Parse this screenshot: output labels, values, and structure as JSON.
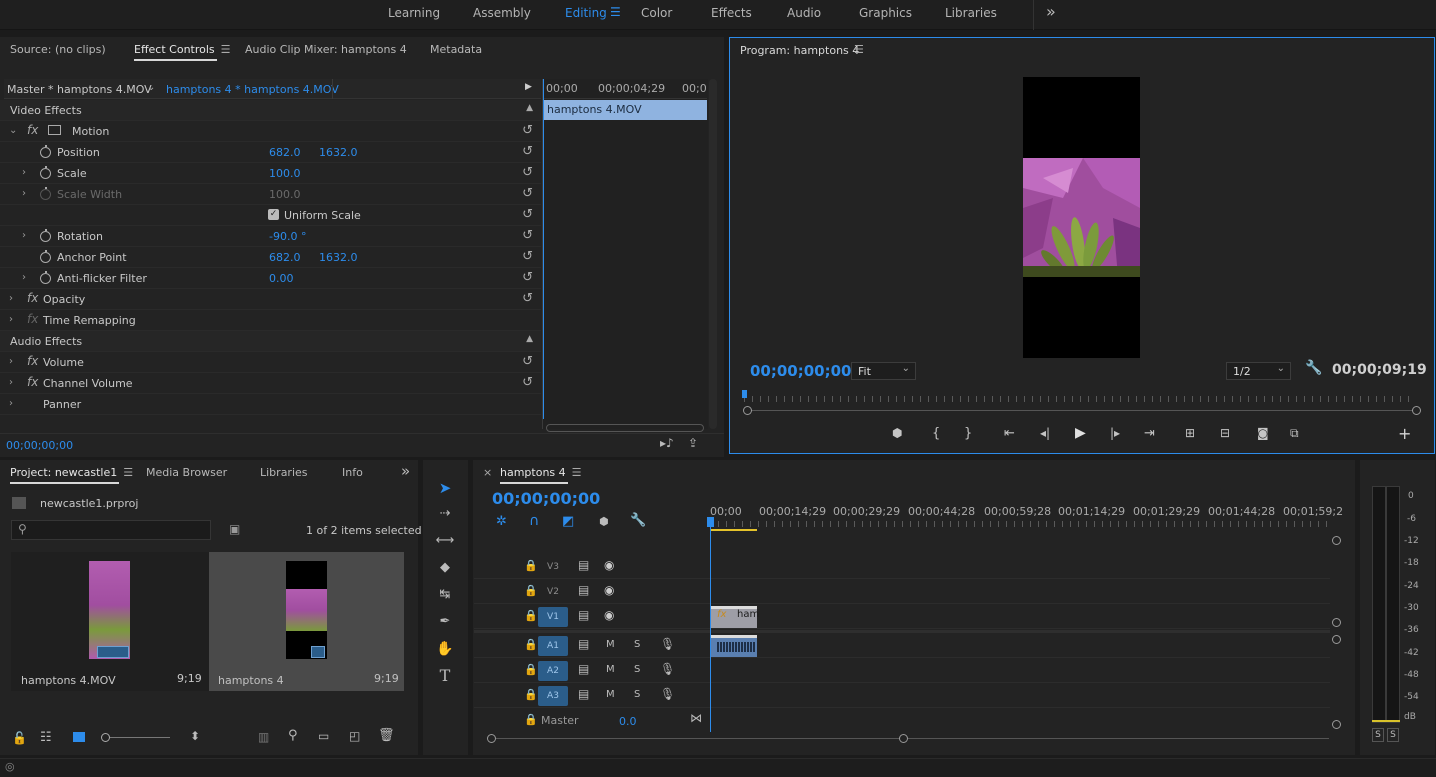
{
  "workspaces": {
    "items": [
      "Learning",
      "Assembly",
      "Editing",
      "Color",
      "Effects",
      "Audio",
      "Graphics",
      "Libraries"
    ],
    "active": "Editing",
    "more": "»"
  },
  "source_panel": {
    "tabs": [
      "Source: (no clips)",
      "Effect Controls",
      "Audio Clip Mixer: hamptons 4",
      "Metadata"
    ],
    "active_tab": "Effect Controls",
    "master_label": "Master * hamptons 4.MOV",
    "sequence_clip": "hamptons 4 * hamptons 4.MOV",
    "video_effects": "Video Effects",
    "audio_effects": "Audio Effects",
    "motion": "Motion",
    "position": {
      "label": "Position",
      "x": "682.0",
      "y": "1632.0"
    },
    "scale": {
      "label": "Scale",
      "value": "100.0"
    },
    "scale_width": {
      "label": "Scale Width",
      "value": "100.0"
    },
    "uniform_scale": "Uniform Scale",
    "rotation": {
      "label": "Rotation",
      "value": "-90.0 °"
    },
    "anchor": {
      "label": "Anchor Point",
      "x": "682.0",
      "y": "1632.0"
    },
    "antiflicker": {
      "label": "Anti-flicker Filter",
      "value": "0.00"
    },
    "opacity": "Opacity",
    "time_remap": "Time Remapping",
    "volume": "Volume",
    "channel_volume": "Channel Volume",
    "panner": "Panner",
    "timecode": "00;00;00;00",
    "mini_ruler": [
      "00;00",
      "00;00;04;29",
      "00;0"
    ],
    "mini_clip": "hamptons 4.MOV",
    "fx_label": "fx"
  },
  "program": {
    "title": "Program: hamptons 4",
    "timecode": "00;00;00;00",
    "fit": "Fit",
    "resolution": "1/2",
    "duration": "00;00;09;19"
  },
  "project": {
    "tabs": [
      "Project: newcastle1",
      "Media Browser",
      "Libraries",
      "Info"
    ],
    "active_tab": "Project: newcastle1",
    "file": "newcastle1.prproj",
    "selected": "1 of 2 items selected",
    "items": [
      {
        "name": "hamptons 4.MOV",
        "duration": "9;19"
      },
      {
        "name": "hamptons 4",
        "duration": "9;19"
      }
    ]
  },
  "timeline": {
    "tab": "hamptons 4",
    "close": "×",
    "timecode": "00;00;00;00",
    "ruler": [
      "00;00",
      "00;00;14;29",
      "00;00;29;29",
      "00;00;44;28",
      "00;00;59;28",
      "00;01;14;29",
      "00;01;29;29",
      "00;01;44;28",
      "00;01;59;2"
    ],
    "video_tracks": [
      "V3",
      "V2",
      "V1"
    ],
    "audio_tracks": [
      "A1",
      "A2",
      "A3"
    ],
    "mute": "M",
    "solo": "S",
    "master": "Master",
    "master_value": "0.0",
    "clip_label": "ham"
  },
  "meter": {
    "scale": [
      "0",
      "-6",
      "-12",
      "-18",
      "-24",
      "-30",
      "-36",
      "-42",
      "-48",
      "-54",
      "dB"
    ],
    "solo_buttons": [
      "S",
      "S"
    ]
  },
  "colors": {
    "accent": "#2d8ceb",
    "panel": "#232323",
    "clip": "#8fb3e0"
  }
}
